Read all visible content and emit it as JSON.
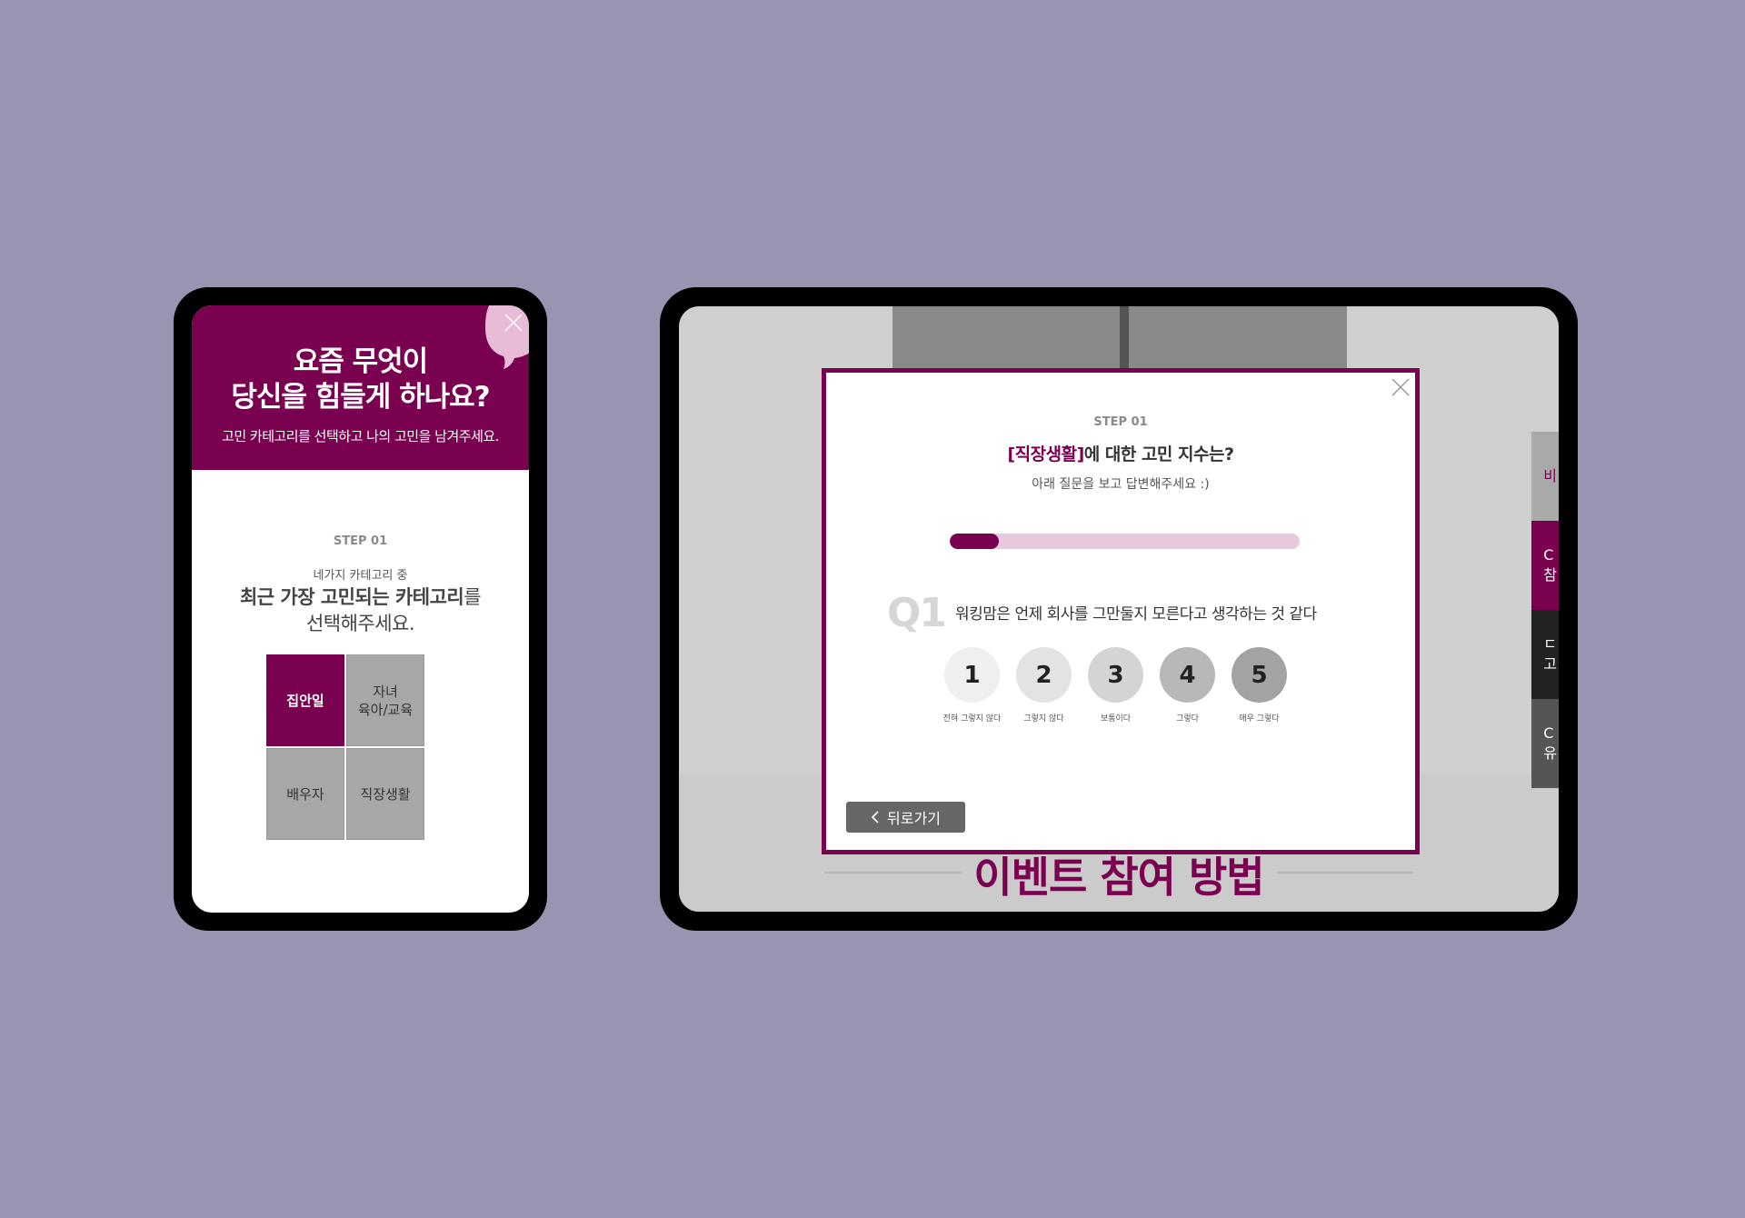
{
  "mobile": {
    "header": {
      "title": "요즘 무엇이\n당신을 힘들게 하나요?",
      "subtitle": "고민 카테고리를 선택하고 나의 고민을 남겨주세요."
    },
    "step_label": "STEP 01",
    "lead": "네가지 카테고리 중",
    "question_bold": "최근 가장 고민되는 카테고리",
    "question_suffix": "를",
    "question_line2": "선택해주세요.",
    "categories": [
      {
        "label": "집안일",
        "selected": true
      },
      {
        "label": "자녀\n육아/교육",
        "selected": false
      },
      {
        "label": "배우자",
        "selected": false
      },
      {
        "label": "직장생활",
        "selected": false
      }
    ]
  },
  "tablet": {
    "background_heading": "이벤트 참여 방법",
    "side_tabs": [
      {
        "text": "비",
        "bg": "#a9a9a9",
        "color": "#7a0050"
      },
      {
        "text": "C\n참",
        "bg": "#7a0050",
        "color": "#ffffff"
      },
      {
        "text": "ㄷ\n고",
        "bg": "#222222",
        "color": "#ffffff"
      },
      {
        "text": "C\n유",
        "bg": "#555555",
        "color": "#ffffff"
      }
    ],
    "modal": {
      "step_label": "STEP 01",
      "title_category": "[직장생활]",
      "title_rest": "에 대한 고민 지수는?",
      "subtitle": "아래 질문을 보고 답변해주세요 :)",
      "progress": 0.14,
      "question_number": "Q1",
      "question_text": "워킹맘은 언제 회사를 그만둘지 모른다고 생각하는 것 같다",
      "options": [
        {
          "value": "1",
          "label": "전혀 그렇지 않다",
          "color": "#efefef"
        },
        {
          "value": "2",
          "label": "그렇지 않다",
          "color": "#e3e3e3"
        },
        {
          "value": "3",
          "label": "보통이다",
          "color": "#d4d4d4"
        },
        {
          "value": "4",
          "label": "그렇다",
          "color": "#b8b8b8"
        },
        {
          "value": "5",
          "label": "매우 그렇다",
          "color": "#a3a3a3"
        }
      ],
      "back_label": "뒤로가기"
    }
  },
  "colors": {
    "background": "#9795b2",
    "brand": "#7a0050",
    "progress_track": "#e6c9dc"
  }
}
